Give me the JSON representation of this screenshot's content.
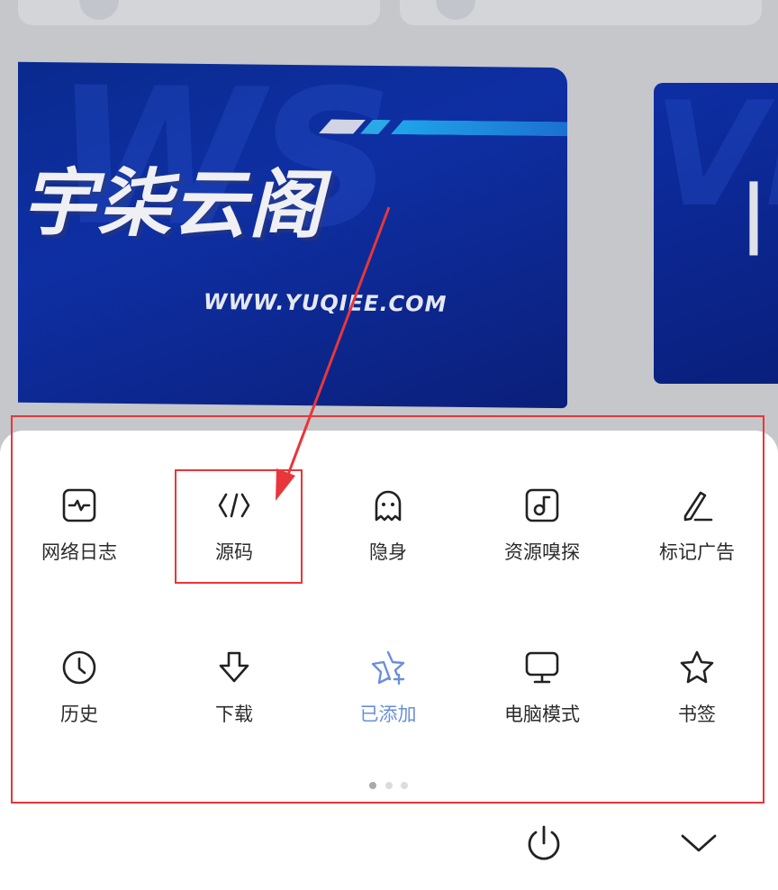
{
  "banner": {
    "title": "宇柒云阁",
    "url": "WWW.YUQIEE.COM",
    "watermark": "WS",
    "side_watermark": "VE",
    "side_fragment": "|"
  },
  "menu": {
    "row1": [
      {
        "label": "网络日志",
        "icon": "network-log-icon"
      },
      {
        "label": "源码",
        "icon": "source-code-icon"
      },
      {
        "label": "隐身",
        "icon": "ghost-icon"
      },
      {
        "label": "资源嗅探",
        "icon": "music-note-icon"
      },
      {
        "label": "标记广告",
        "icon": "pen-icon"
      }
    ],
    "row2": [
      {
        "label": "历史",
        "icon": "clock-icon"
      },
      {
        "label": "下载",
        "icon": "download-icon"
      },
      {
        "label": "已添加",
        "icon": "star-add-icon",
        "active": true
      },
      {
        "label": "电脑模式",
        "icon": "monitor-icon"
      },
      {
        "label": "书签",
        "icon": "star-icon"
      }
    ]
  },
  "pager": {
    "pages": 3,
    "current": 1
  },
  "colors": {
    "highlight": "#e8363a",
    "active_label": "#6a8fda",
    "sheet_bg": "#ffffff",
    "backdrop": "#c6c7ca"
  }
}
